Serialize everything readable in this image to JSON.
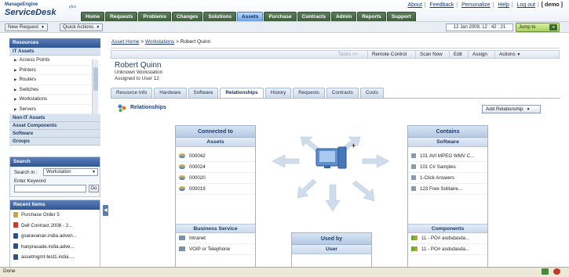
{
  "app": {
    "logo_small": "ManageEngine",
    "logo_main": "ServiceDesk",
    "logo_plus": "plus"
  },
  "top_links": [
    "About",
    "Feedback",
    "Personalize",
    "Help",
    "Log out"
  ],
  "user": "[ demo ]",
  "nav": [
    "Home",
    "Requests",
    "Problems",
    "Changes",
    "Solutions",
    "Assets",
    "Purchase",
    "Contracts",
    "Admin",
    "Reports",
    "Support"
  ],
  "nav_active": "Assets",
  "toolbar": {
    "new_request": "New Request",
    "quick_actions": "Quick Actions",
    "datetime": "12 Jan 2009, 12 : 42 : 21",
    "jump_to": "Jump to"
  },
  "sidebar": {
    "resources_title": "Resources",
    "it_assets": "IT Assets",
    "items": [
      "Access Points",
      "Printers",
      "Routers",
      "Switches",
      "Workstations",
      "Servers"
    ],
    "categories": [
      "Non-IT Assets",
      "Asset Components",
      "Software",
      "Groups"
    ]
  },
  "search": {
    "title": "Search",
    "search_in_label": "Search in :",
    "search_in_value": "Workstation",
    "keyword_label": "Enter Keyword",
    "go": "Go"
  },
  "recent": {
    "title": "Recent Items",
    "items": [
      "Purchase Order 5",
      "Dell Contract 2008 - 2...",
      "gsaravanan.india.adven...",
      "hanprasade.india.adve...",
      "assetmgmt-test1.india...."
    ]
  },
  "breadcrumb": {
    "home": "Asset Home",
    "sep": ">",
    "section": "Workstations",
    "current": "Robert Quinn"
  },
  "actions": [
    "Tasks >>",
    "Remote Control",
    "Scan Now",
    "Edit",
    "Assign",
    "Actions"
  ],
  "asset": {
    "name": "Robert Quinn",
    "type": "Unknown Workstation",
    "assigned": "Assigned to User 12"
  },
  "tabs": [
    "Resource Info",
    "Hardware",
    "Software",
    "Relationships",
    "History",
    "Requests",
    "Contracts",
    "Costs"
  ],
  "tab_active": "Relationships",
  "relationships": {
    "title": "Relationships",
    "add_button": "Add Relationship",
    "connected_to": {
      "title": "Connected to",
      "assets_header": "Assets",
      "assets": [
        "000042",
        "000024",
        "000020",
        "000019"
      ],
      "business_header": "Business Service",
      "business": [
        "Intranet",
        "VOIP or Telephone"
      ]
    },
    "contains": {
      "title": "Contains",
      "software_header": "Software",
      "software": [
        "101 AVI MPEG WMV C...",
        "101 C# Samples",
        "1-Click Answers",
        "123 Free Solitaire..."
      ],
      "components_header": "Components",
      "components": [
        "11 - PO# asdsdasda...",
        "11 - PO# asdsdasda..."
      ]
    },
    "used_by": {
      "title": "Used by",
      "user_header": "User"
    },
    "plus": "+"
  },
  "status": {
    "done": "Done"
  }
}
